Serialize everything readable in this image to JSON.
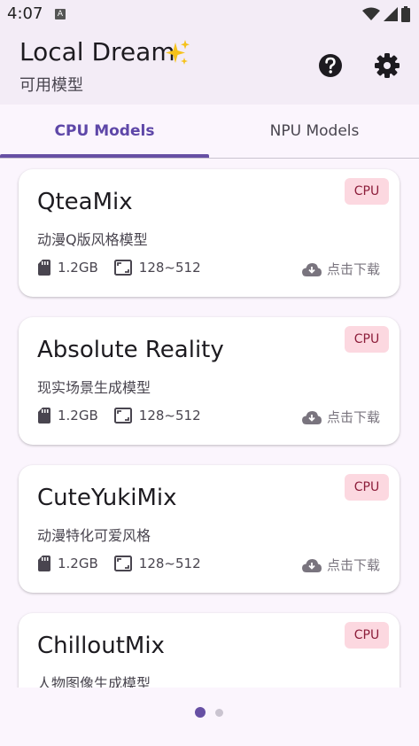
{
  "status_bar": {
    "time": "4:07",
    "notification_badge": "A"
  },
  "app_bar": {
    "title": "Local Dream",
    "title_emoji_icon": "sparkles-icon",
    "subtitle": "可用模型",
    "help_icon": "help-circle-icon",
    "settings_icon": "gear-icon"
  },
  "tabs": [
    {
      "label": "CPU Models",
      "selected": true
    },
    {
      "label": "NPU Models",
      "selected": false
    }
  ],
  "models": [
    {
      "name": "QteaMix",
      "description": "动漫Q版风格模型",
      "size": "1.2GB",
      "resolution": "128~512",
      "badge": "CPU",
      "action": "点击下载"
    },
    {
      "name": "Absolute Reality",
      "description": "现实场景生成模型",
      "size": "1.2GB",
      "resolution": "128~512",
      "badge": "CPU",
      "action": "点击下载"
    },
    {
      "name": "CuteYukiMix",
      "description": "动漫特化可爱风格",
      "size": "1.2GB",
      "resolution": "128~512",
      "badge": "CPU",
      "action": "点击下载"
    },
    {
      "name": "ChilloutMix",
      "description": "人物图像生成模型",
      "badge": "CPU"
    }
  ],
  "pager": {
    "page_count": 2,
    "current_page": 1
  },
  "colors": {
    "primary": "#6750a4",
    "badge_bg": "#fcd8e0",
    "badge_text": "#8c1d3a",
    "app_bar_bg": "#f3ecf6"
  }
}
